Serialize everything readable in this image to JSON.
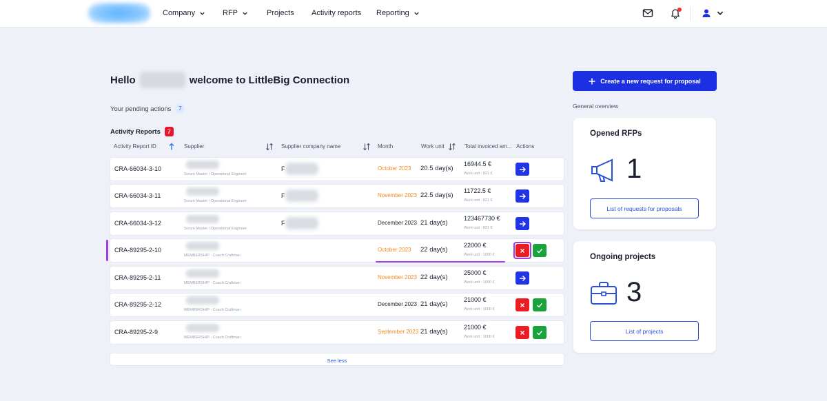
{
  "nav": {
    "items": [
      {
        "label": "Company",
        "has_dropdown": true
      },
      {
        "label": "RFP",
        "has_dropdown": true
      },
      {
        "label": "Projects",
        "has_dropdown": false
      },
      {
        "label": "Activity reports",
        "has_dropdown": false
      },
      {
        "label": "Reporting",
        "has_dropdown": true
      }
    ],
    "icons": [
      "mail-icon",
      "bell-icon",
      "user-icon"
    ]
  },
  "greeting": {
    "hello": "Hello",
    "welcome": "welcome to LittleBig Connection"
  },
  "pending": {
    "label": "Your pending actions",
    "count": "7"
  },
  "activity_reports": {
    "title": "Activity Reports",
    "count": "7",
    "columns": [
      "Activity Report ID",
      "Supplier",
      "Supplier company name",
      "Month",
      "Work unit",
      "Total invoiced am...",
      "Actions"
    ],
    "rows": [
      {
        "id": "CRA-66034-3-10",
        "role": "Scrum Master / Operational Engineer",
        "company_initial": "F",
        "month": "October 2023",
        "month_color": "orange",
        "work_unit": "20.5 day(s)",
        "amount": "16944.5 €",
        "amount_sub": "Work unit : 821 €",
        "actions": "go"
      },
      {
        "id": "CRA-66034-3-11",
        "role": "Scrum Master / Operational Engineer",
        "company_initial": "F",
        "month": "November 2023",
        "month_color": "orange",
        "work_unit": "22.5 day(s)",
        "amount": "11722.5 €",
        "amount_sub": "Work unit : 821 €",
        "actions": "go"
      },
      {
        "id": "CRA-66034-3-12",
        "role": "Scrum Master / Operational Engineer",
        "company_initial": "F",
        "month": "December 2023",
        "month_color": "dark",
        "work_unit": "21 day(s)",
        "amount": "123467730 €",
        "amount_sub": "Work unit : 821 €",
        "actions": "go"
      },
      {
        "id": "CRA-89295-2-10",
        "role": "MEMBERSHIP - Coach Craftman",
        "company_initial": "",
        "month": "October 2023",
        "month_color": "orange",
        "work_unit": "22 day(s)",
        "amount": "22000 €",
        "amount_sub": "Work unit : 1000 €",
        "actions": "approve"
      },
      {
        "id": "CRA-89295-2-11",
        "role": "MEMBERSHIP - Coach Craftman",
        "company_initial": "",
        "month": "November 2023",
        "month_color": "orange",
        "work_unit": "22 day(s)",
        "amount": "25000 €",
        "amount_sub": "Work unit : 1000 €",
        "actions": "go"
      },
      {
        "id": "CRA-89295-2-12",
        "role": "MEMBERSHIP - Coach Craftman",
        "company_initial": "",
        "month": "December 2023",
        "month_color": "dark",
        "work_unit": "21 day(s)",
        "amount": "21000 €",
        "amount_sub": "Work unit : 1000 €",
        "actions": "approve"
      },
      {
        "id": "CRA-89295-2-9",
        "role": "MEMBERSHIP - Coach Craftman",
        "company_initial": "",
        "month": "September 2023",
        "month_color": "orange",
        "work_unit": "21 day(s)",
        "amount": "21000 €",
        "amount_sub": "Work unit : 1000 €",
        "actions": "approve"
      }
    ],
    "see_less": "See less"
  },
  "right": {
    "cta_label": "Create a new request for proposal",
    "general_overview": "General overview",
    "opened_rfps": {
      "title": "Opened RFPs",
      "count": "1",
      "button": "List of requests for proposals"
    },
    "ongoing_projects": {
      "title": "Ongoing projects",
      "count": "3",
      "button": "List of projects"
    }
  },
  "colors": {
    "primary": "#1c2fe3",
    "orange_month": "#f08a1c",
    "reject": "#ec1c24",
    "approve": "#1aa33a",
    "highlight": "#a23ee0"
  }
}
